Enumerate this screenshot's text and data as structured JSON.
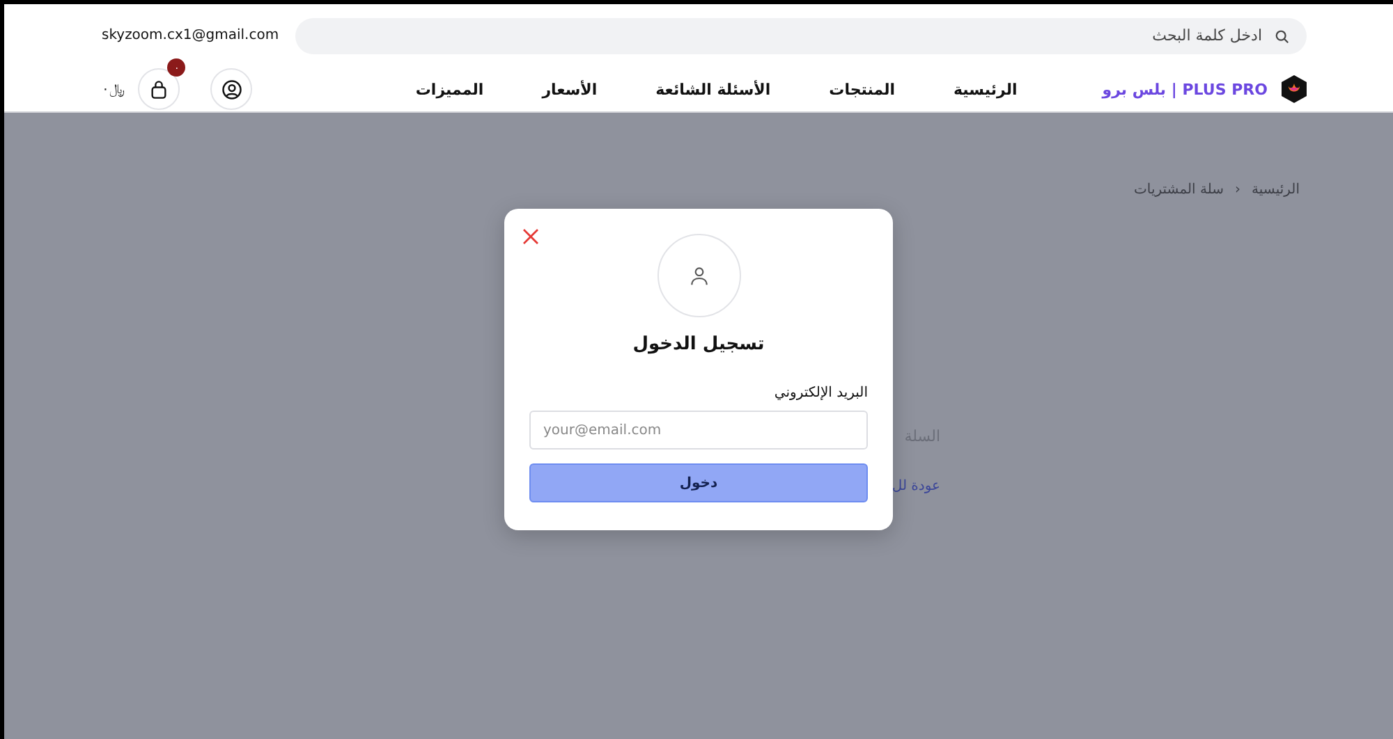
{
  "header": {
    "email": "skyzoom.cx1@gmail.com",
    "search": {
      "placeholder": "ادخل كلمة البحث"
    },
    "brand": "بلس برو | PLUS PRO",
    "nav": [
      {
        "label": "الرئيسية"
      },
      {
        "label": "المنتجات"
      },
      {
        "label": "الأسئلة الشائعة"
      },
      {
        "label": "الأسعار"
      },
      {
        "label": "المميزات"
      }
    ],
    "cart": {
      "badge": "٠",
      "total": "﷼٠"
    }
  },
  "breadcrumb": [
    "الرئيسية",
    "›",
    "سلة المشتريات"
  ],
  "background": {
    "empty_text": "السلة",
    "link": "عودة لل"
  },
  "login_dialog": {
    "title": "تسجيل الدخول",
    "email_label": "البريد الإلكتروني",
    "email_placeholder": "your@email.com",
    "submit": "دخول"
  }
}
